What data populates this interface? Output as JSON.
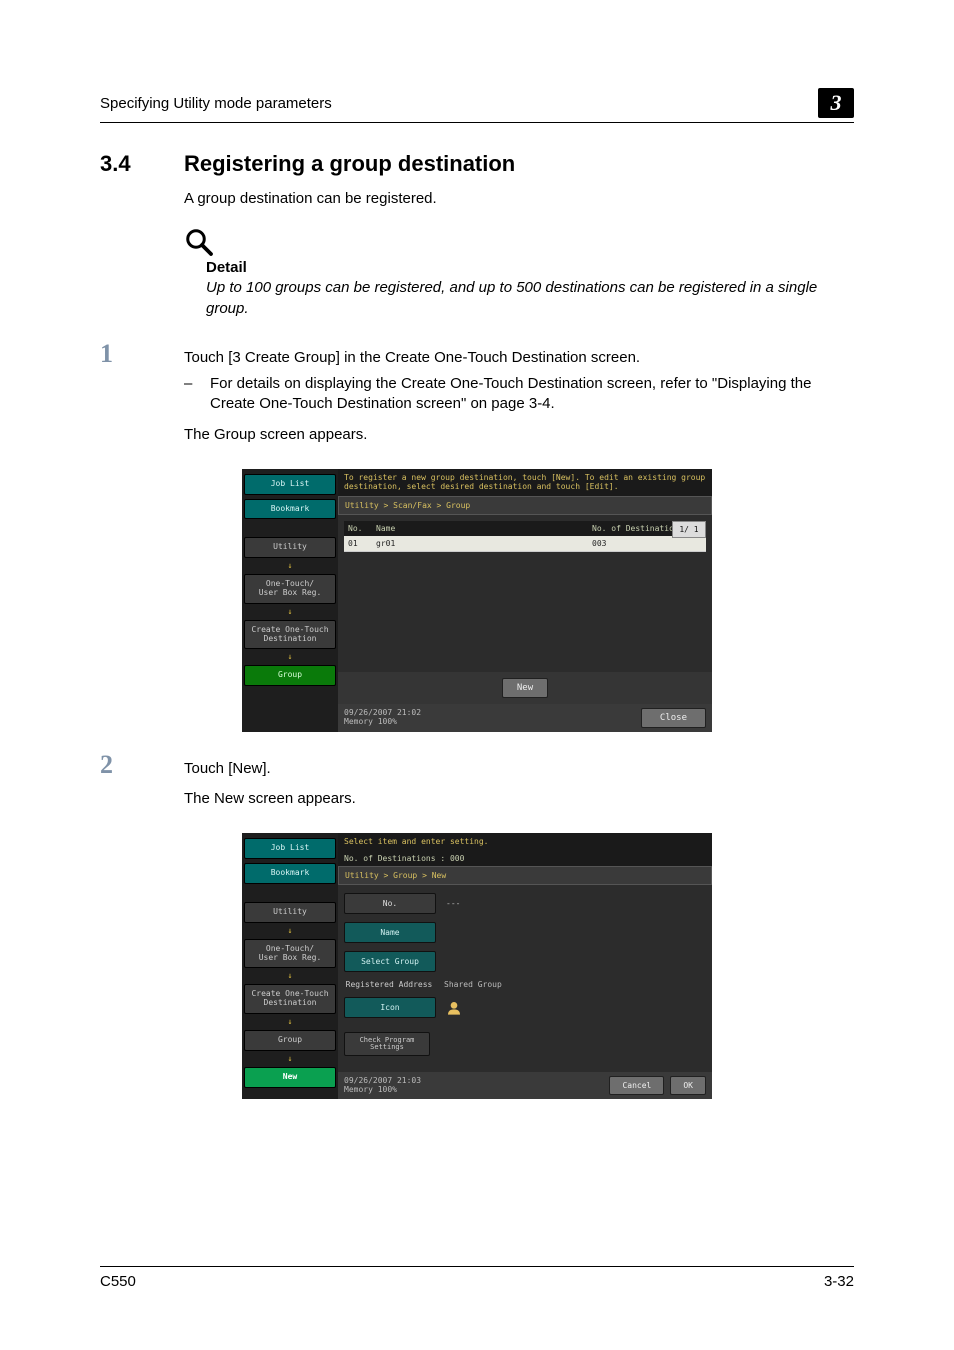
{
  "header": {
    "running_title": "Specifying Utility mode parameters",
    "chapter_badge": "3"
  },
  "section": {
    "number": "3.4",
    "title": "Registering a group destination",
    "intro": "A group destination can be registered."
  },
  "detail": {
    "label": "Detail",
    "text": "Up to 100 groups can be registered, and up to 500 destinations can be registered in a single group."
  },
  "steps": [
    {
      "num": "1",
      "text": "Touch [3 Create Group] in the Create One-Touch Destination screen.",
      "sub": "For details on displaying the Create One-Touch Destination screen, refer to \"Displaying the Create One-Touch Destination screen\" on page 3-4.",
      "after": "The Group screen appears."
    },
    {
      "num": "2",
      "text": "Touch [New].",
      "after": "The New screen appears."
    }
  ],
  "screenshot1": {
    "side": {
      "job_list": "Job List",
      "bookmark": "Bookmark",
      "utility": "Utility",
      "one_touch": "One-Touch/\nUser Box Reg.",
      "create": "Create One-Touch\nDestination",
      "group": "Group"
    },
    "instruction": "To register a new group destination, touch [New]. To edit an existing group destination, select desired destination and touch [Edit].",
    "breadcrumb": "Utility > Scan/Fax > Group",
    "columns": {
      "no": "No.",
      "name": "Name",
      "dest": "No. of Destinations"
    },
    "row": {
      "no": "01",
      "name": "gr01",
      "dest": "003"
    },
    "page_indicator": "1/  1",
    "new_btn": "New",
    "footer_date": "09/26/2007   21:02",
    "footer_mem": "Memory       100%",
    "close": "Close"
  },
  "screenshot2": {
    "side": {
      "job_list": "Job List",
      "bookmark": "Bookmark",
      "utility": "Utility",
      "one_touch": "One-Touch/\nUser Box Reg.",
      "create": "Create One-Touch\nDestination",
      "group": "Group",
      "new": "New"
    },
    "instruction": "Select item and enter setting.",
    "dest_count": "No. of Destinations :    000",
    "breadcrumb": "Utility > Group > New",
    "fields": {
      "no_label": "No.",
      "no_val": "---",
      "name": "Name",
      "select_group": "Select Group",
      "reg_addr_label": "Registered Address",
      "reg_addr_val": "Shared Group",
      "icon": "Icon",
      "check_program": "Check Program\nSettings"
    },
    "footer_date": "09/26/2007   21:03",
    "footer_mem": "Memory       100%",
    "cancel": "Cancel",
    "ok": "OK"
  },
  "footer": {
    "model": "C550",
    "pagenum": "3-32"
  }
}
